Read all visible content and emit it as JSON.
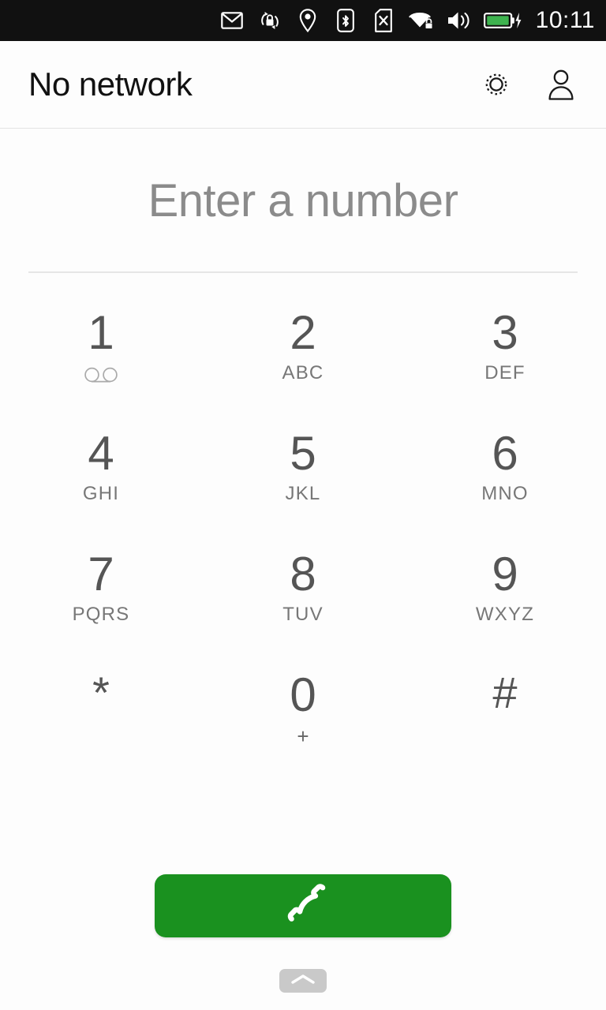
{
  "statusbar": {
    "clock": "10:11",
    "icons": [
      {
        "name": "envelope-icon",
        "label": "messages"
      },
      {
        "name": "rotation-lock-icon",
        "label": "rotation locked"
      },
      {
        "name": "location-pin-icon",
        "label": "location"
      },
      {
        "name": "bluetooth-icon",
        "label": "bluetooth"
      },
      {
        "name": "sim-card-missing-icon",
        "label": "no sim"
      },
      {
        "name": "wifi-secure-icon",
        "label": "wifi secured"
      },
      {
        "name": "volume-icon",
        "label": "sound"
      },
      {
        "name": "battery-charging-icon",
        "label": "battery charging"
      }
    ],
    "battery_color": "#3eb34f",
    "background": "#111111"
  },
  "header": {
    "title": "No network",
    "settings_label": "Settings",
    "contacts_label": "Contacts"
  },
  "entry": {
    "placeholder": "Enter a number",
    "value": ""
  },
  "keypad": {
    "keys": [
      {
        "digit": "1",
        "sub": "",
        "icon": "voicemail-icon",
        "name": "key-1"
      },
      {
        "digit": "2",
        "sub": "ABC",
        "icon": "",
        "name": "key-2"
      },
      {
        "digit": "3",
        "sub": "DEF",
        "icon": "",
        "name": "key-3"
      },
      {
        "digit": "4",
        "sub": "GHI",
        "icon": "",
        "name": "key-4"
      },
      {
        "digit": "5",
        "sub": "JKL",
        "icon": "",
        "name": "key-5"
      },
      {
        "digit": "6",
        "sub": "MNO",
        "icon": "",
        "name": "key-6"
      },
      {
        "digit": "7",
        "sub": "PQRS",
        "icon": "",
        "name": "key-7"
      },
      {
        "digit": "8",
        "sub": "TUV",
        "icon": "",
        "name": "key-8"
      },
      {
        "digit": "9",
        "sub": "WXYZ",
        "icon": "",
        "name": "key-9"
      },
      {
        "digit": "*",
        "sub": "",
        "icon": "",
        "name": "key-star"
      },
      {
        "digit": "0",
        "sub": "+",
        "icon": "",
        "name": "key-0"
      },
      {
        "digit": "#",
        "sub": "",
        "icon": "",
        "name": "key-hash"
      }
    ]
  },
  "call_button": {
    "label": "Call",
    "icon": "phone-handset-icon",
    "color": "#1a911f"
  },
  "bottom_handle": {
    "icon": "chevron-up-icon",
    "label": "Show bottom edge"
  }
}
